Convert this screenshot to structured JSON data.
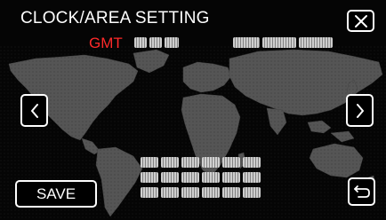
{
  "header": {
    "title": "CLOCK/AREA SETTING",
    "timezone_prefix": "GMT"
  },
  "buttons": {
    "close_icon": "close-icon",
    "prev_icon": "chevron-left-icon",
    "next_icon": "chevron-right-icon",
    "return_icon": "return-icon",
    "save_label": "SAVE"
  },
  "colors": {
    "background": "#050505",
    "map_land": "#595959",
    "map_land_dark": "#3f3f3f",
    "gmt_text": "#ff2a2a",
    "text": "#ffffff",
    "button_border": "#ffffff"
  }
}
